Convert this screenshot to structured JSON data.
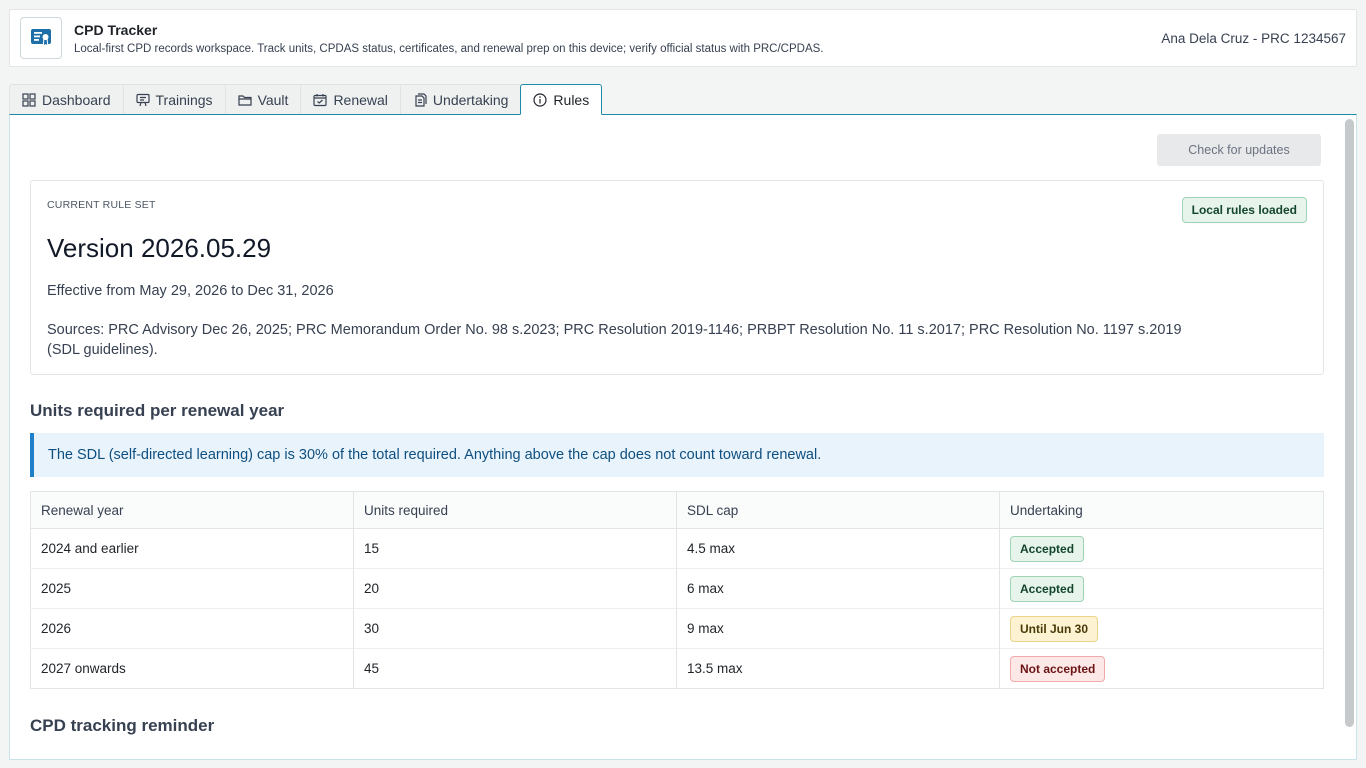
{
  "header": {
    "title": "CPD Tracker",
    "subtitle": "Local-first CPD records workspace. Track units, CPDAS status, certificates, and renewal prep on this device; verify official status with PRC/CPDAS.",
    "user": "Ana Dela Cruz - PRC 1234567",
    "logo_icon": "certificate-icon"
  },
  "tabs": [
    {
      "label": "Dashboard",
      "icon": "grid-icon",
      "active": false
    },
    {
      "label": "Trainings",
      "icon": "presentation-icon",
      "active": false
    },
    {
      "label": "Vault",
      "icon": "folder-icon",
      "active": false
    },
    {
      "label": "Renewal",
      "icon": "calendar-check-icon",
      "active": false
    },
    {
      "label": "Undertaking",
      "icon": "documents-icon",
      "active": false
    },
    {
      "label": "Rules",
      "icon": "info-icon",
      "active": true
    }
  ],
  "toolbar": {
    "check_updates_label": "Check for updates",
    "check_updates_disabled": true
  },
  "rule_set": {
    "eyebrow": "CURRENT RULE SET",
    "badge": "Local rules loaded",
    "version": "Version 2026.05.29",
    "effective": "Effective from May 29, 2026 to Dec 31, 2026",
    "sources": "Sources: PRC Advisory Dec 26, 2025; PRC Memorandum Order No. 98 s.2023; PRC Resolution 2019-1146; PRBPT Resolution No. 11 s.2017; PRC Resolution No. 1197 s.2019 (SDL guidelines)."
  },
  "units_section": {
    "title": "Units required per renewal year",
    "callout": "The SDL (self-directed learning) cap is 30% of the total required. Anything above the cap does not count toward renewal.",
    "columns": [
      "Renewal year",
      "Units required",
      "SDL cap",
      "Undertaking"
    ],
    "rows": [
      {
        "year": "2024 and earlier",
        "units": "15",
        "sdl": "4.5 max",
        "undertaking": "Accepted",
        "status": "accepted"
      },
      {
        "year": "2025",
        "units": "20",
        "sdl": "6 max",
        "undertaking": "Accepted",
        "status": "accepted"
      },
      {
        "year": "2026",
        "units": "30",
        "sdl": "9 max",
        "undertaking": "Until Jun 30",
        "status": "until"
      },
      {
        "year": "2027 onwards",
        "units": "45",
        "sdl": "13.5 max",
        "undertaking": "Not accepted",
        "status": "rejected"
      }
    ]
  },
  "reminder_section": {
    "title": "CPD tracking reminder"
  },
  "colors": {
    "accent": "#1d8aa6",
    "info_border": "#1f7fc7",
    "info_bg": "#e8f3fb",
    "success_bg": "#e6f4ec",
    "warning_bg": "#fdf3d3",
    "danger_bg": "#fde8e8"
  }
}
